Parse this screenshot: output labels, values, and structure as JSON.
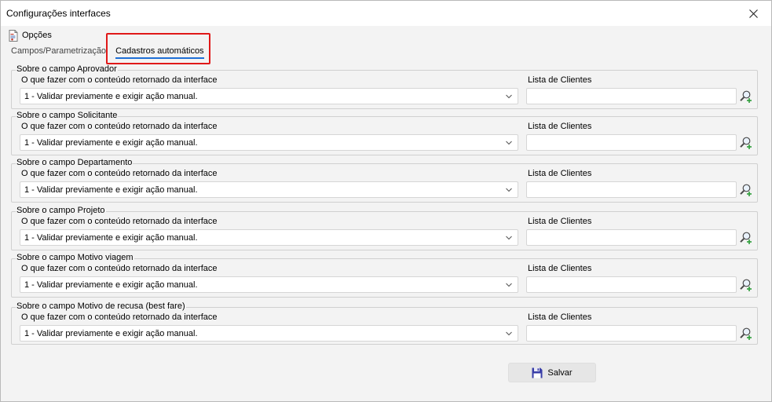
{
  "window": {
    "title": "Configurações interfaces"
  },
  "options": {
    "label": "Opções"
  },
  "tabs": [
    {
      "label": "Campos/Parametrização",
      "active": false
    },
    {
      "label": "Cadastros automáticos",
      "active": true
    }
  ],
  "groups": [
    {
      "legend": "Sobre o campo Aprovador",
      "action_label": "O que fazer com o conteúdo retornado da interface",
      "action_value": "1 - Validar previamente e exigir ação manual.",
      "clients_label": "Lista de Clientes",
      "clients_value": ""
    },
    {
      "legend": "Sobre o campo Solicitante",
      "action_label": "O que fazer com o conteúdo retornado da interface",
      "action_value": "1 - Validar previamente e exigir ação manual.",
      "clients_label": "Lista de Clientes",
      "clients_value": ""
    },
    {
      "legend": "Sobre o campo Departamento",
      "action_label": "O que fazer com o conteúdo retornado da interface",
      "action_value": "1 - Validar previamente e exigir ação manual.",
      "clients_label": "Lista de Clientes",
      "clients_value": ""
    },
    {
      "legend": "Sobre o campo Projeto",
      "action_label": "O que fazer com o conteúdo retornado da interface",
      "action_value": "1 - Validar previamente e exigir ação manual.",
      "clients_label": "Lista de Clientes",
      "clients_value": ""
    },
    {
      "legend": "Sobre o campo Motivo viagem",
      "action_label": "O que fazer com o conteúdo retornado da interface",
      "action_value": "1 - Validar previamente e exigir ação manual.",
      "clients_label": "Lista de Clientes",
      "clients_value": ""
    },
    {
      "legend": "Sobre o campo Motivo de recusa (best fare)",
      "action_label": "O que fazer com o conteúdo retornado da interface",
      "action_value": "1 - Validar previamente e exigir ação manual.",
      "clients_label": "Lista de Clientes",
      "clients_value": ""
    }
  ],
  "footer": {
    "save_label": "Salvar"
  },
  "icons": {
    "close": "close-icon",
    "options": "document-gear-icon",
    "lookup": "search-add-icon",
    "dropdown": "chevron-down-icon",
    "save": "floppy-disk-icon"
  },
  "colors": {
    "highlight": "#e01818",
    "active_tab_underline": "#1f6fd6",
    "lookup_plus": "#2e9e3a",
    "save_icon": "#3a3fa8"
  }
}
